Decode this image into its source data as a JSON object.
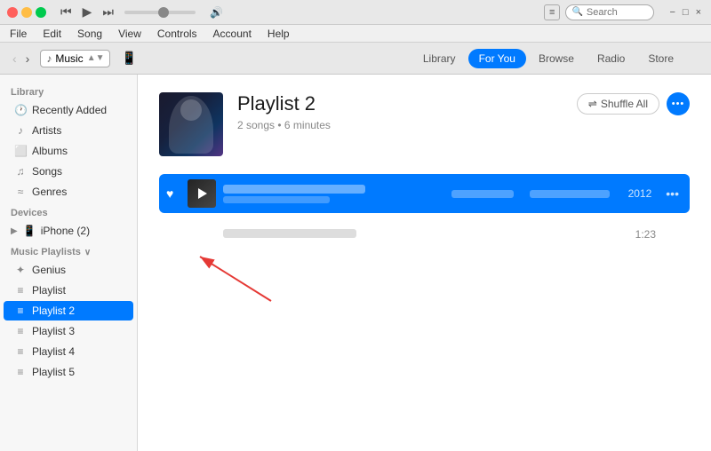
{
  "titleBar": {
    "transportBack": "⏮",
    "transportPlay": "▶",
    "transportForward": "⏭",
    "appleIcon": "",
    "searchPlaceholder": "Search",
    "listViewLabel": "≡",
    "winMin": "−",
    "winMax": "□",
    "winClose": "×"
  },
  "menuBar": {
    "items": [
      "File",
      "Edit",
      "Song",
      "View",
      "Controls",
      "Account",
      "Help"
    ]
  },
  "navBar": {
    "musicLabel": "Music",
    "deviceIcon": "📱",
    "tabs": [
      "Library",
      "For You",
      "Browse",
      "Radio",
      "Store"
    ],
    "activeTab": "Library"
  },
  "sidebar": {
    "librarySection": "Library",
    "libraryItems": [
      {
        "label": "Recently Added",
        "icon": "🕐"
      },
      {
        "label": "Artists",
        "icon": "♪"
      },
      {
        "label": "Albums",
        "icon": "⬜"
      },
      {
        "label": "Songs",
        "icon": "♫"
      },
      {
        "label": "Genres",
        "icon": "≈"
      }
    ],
    "devicesSection": "Devices",
    "deviceItems": [
      {
        "label": "iPhone (2)",
        "icon": "📱"
      }
    ],
    "playlistsSection": "Music Playlists",
    "playlistItems": [
      {
        "label": "Genius",
        "icon": "✦"
      },
      {
        "label": "Playlist",
        "icon": "≡"
      },
      {
        "label": "Playlist 2",
        "icon": "≡",
        "active": true
      },
      {
        "label": "Playlist 3",
        "icon": "≡"
      },
      {
        "label": "Playlist 4",
        "icon": "≡"
      },
      {
        "label": "Playlist 5",
        "icon": "≡"
      }
    ]
  },
  "content": {
    "playlistTitle": "Playlist 2",
    "playlistMeta": "2 songs • 6 minutes",
    "shuffleLabel": "Shuffle All",
    "shuffleIcon": "⇌",
    "moreIcon": "•••",
    "tracks": [
      {
        "id": 1,
        "playing": true,
        "year": "2012",
        "moreIcon": "•••"
      },
      {
        "id": 2,
        "playing": false,
        "duration": "1:23"
      }
    ]
  }
}
